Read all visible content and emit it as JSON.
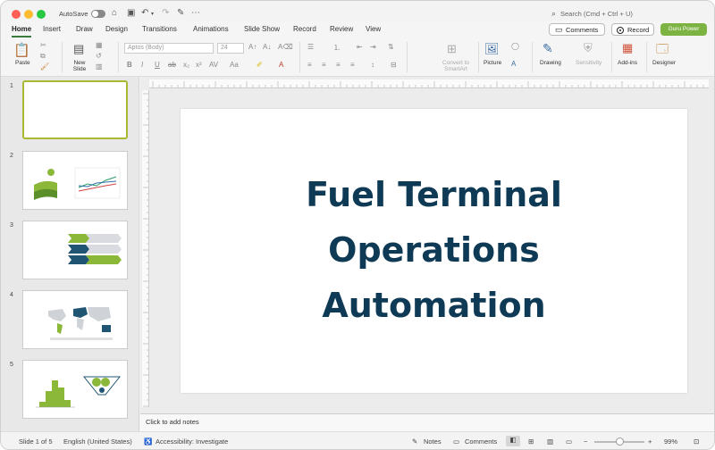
{
  "titlebar": {
    "autosave_label": "AutoSave",
    "search_placeholder": "Search (Cmd + Ctrl + U)"
  },
  "tabs": [
    {
      "label": "Home"
    },
    {
      "label": "Insert"
    },
    {
      "label": "Draw"
    },
    {
      "label": "Design"
    },
    {
      "label": "Transitions"
    },
    {
      "label": "Animations"
    },
    {
      "label": "Slide Show"
    },
    {
      "label": "Record"
    },
    {
      "label": "Review"
    },
    {
      "label": "View"
    }
  ],
  "header_buttons": {
    "comments": "Comments",
    "record": "Record",
    "guru": "Guru Power"
  },
  "ribbon": {
    "paste": "Paste",
    "new_slide": "New Slide",
    "font_name": "Aptos (Body)",
    "font_size": "24",
    "convert_smartart": "Convert to SmartArt",
    "picture": "Picture",
    "drawing": "Drawing",
    "sensitivity": "Sensitivity",
    "addins": "Add-ins",
    "designer": "Designer"
  },
  "slides": [
    {
      "number": "1"
    },
    {
      "number": "2"
    },
    {
      "number": "3"
    },
    {
      "number": "4"
    },
    {
      "number": "5"
    }
  ],
  "slide": {
    "title_lines": [
      "Fuel Terminal",
      "Operations",
      "Automation"
    ]
  },
  "notes_placeholder": "Click to add notes",
  "status": {
    "slide_of": "Slide 1 of 5",
    "language": "English (United States)",
    "accessibility": "Accessibility: Investigate",
    "notes": "Notes",
    "comments": "Comments",
    "zoom": "99%"
  },
  "colors": {
    "title": "#0f3a55",
    "accent_green": "#7cb342",
    "selection": "#a9b830"
  }
}
